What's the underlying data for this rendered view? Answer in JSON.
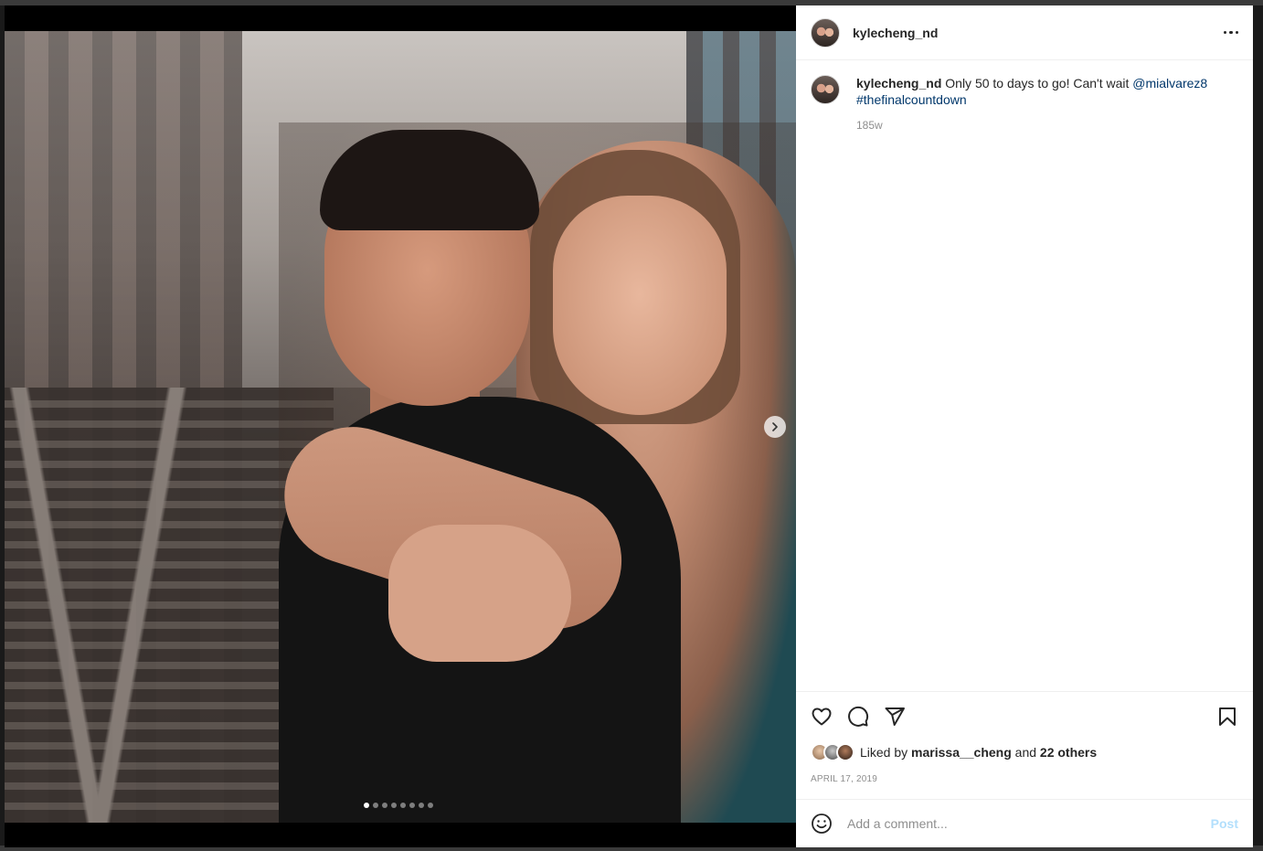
{
  "post": {
    "username": "kylecheng_nd",
    "caption": {
      "username": "kylecheng_nd",
      "text": " Only 50 to days to go! Can't wait ",
      "mention": "@mialvarez8",
      "hashtag": "#thefinalcountdown"
    },
    "time_ago": "185w",
    "likes": {
      "prefix": "Liked by ",
      "user": "marissa__cheng",
      "and": " and ",
      "others": "22 others"
    },
    "date": "April 17, 2019",
    "carousel": {
      "total": 8,
      "active_index": 0
    }
  },
  "comment": {
    "placeholder": "Add a comment...",
    "post_label": "Post"
  },
  "icons": {
    "more": "more-horizontal-icon",
    "like": "heart-icon",
    "comment": "comment-icon",
    "share": "paper-plane-icon",
    "save": "bookmark-icon",
    "emoji": "emoji-icon",
    "next": "chevron-right-icon"
  },
  "colors": {
    "link": "#00376b",
    "muted": "#8e8e8e",
    "post_disabled": "#b2dffc"
  }
}
